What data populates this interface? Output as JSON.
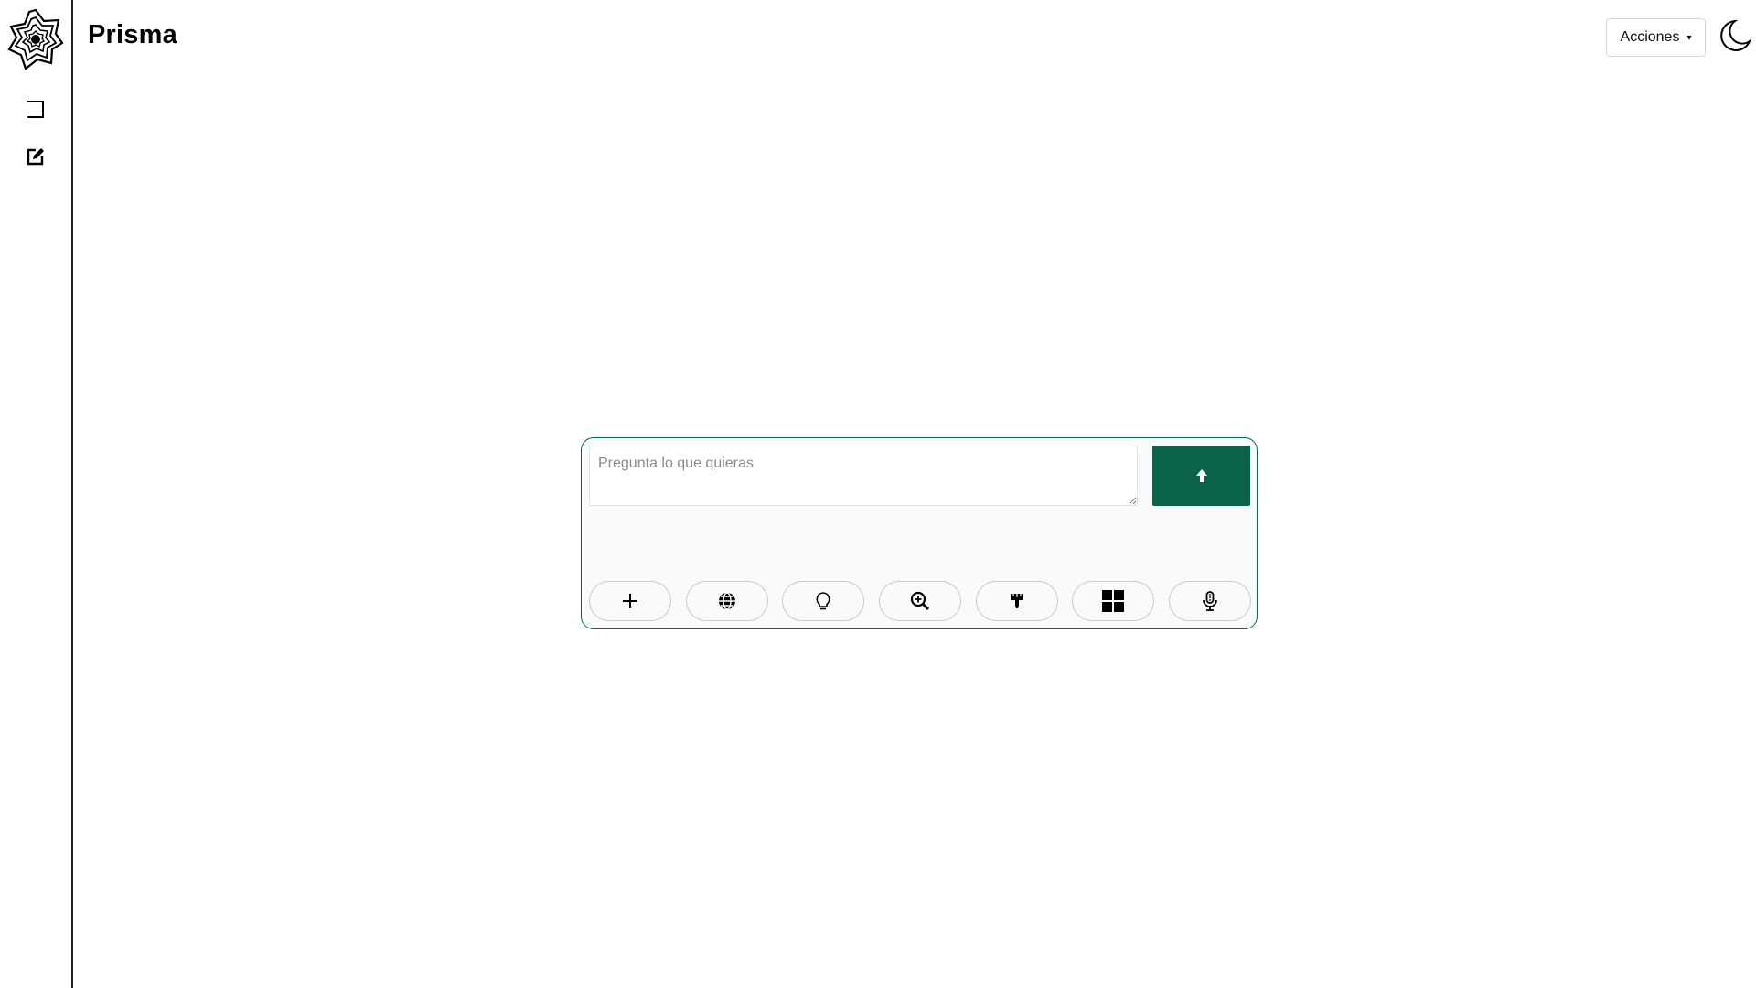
{
  "app": {
    "title": "Prisma"
  },
  "header": {
    "actions_label": "Acciones",
    "actions_caret": "▾"
  },
  "sidebar": {
    "items": [
      {
        "name": "toggle-sidebar",
        "icon": "sidebar-panel-icon"
      },
      {
        "name": "new-chat",
        "icon": "edit-icon"
      }
    ]
  },
  "composer": {
    "placeholder": "Pregunta lo que quieras",
    "value": "",
    "send_icon": "arrow-up-icon",
    "tools": [
      {
        "name": "attach",
        "icon": "plus-icon"
      },
      {
        "name": "web-search",
        "icon": "globe-icon"
      },
      {
        "name": "reasoning",
        "icon": "lightbulb-icon"
      },
      {
        "name": "deep-search",
        "icon": "zoom-in-icon"
      },
      {
        "name": "paint",
        "icon": "paintbrush-icon"
      },
      {
        "name": "apps",
        "icon": "grid-icon"
      },
      {
        "name": "voice",
        "icon": "microphone-icon"
      }
    ]
  },
  "colors": {
    "accent": "#0b634a",
    "composer_border": "#0b6b4f",
    "composer_bg": "#f8fafb"
  }
}
